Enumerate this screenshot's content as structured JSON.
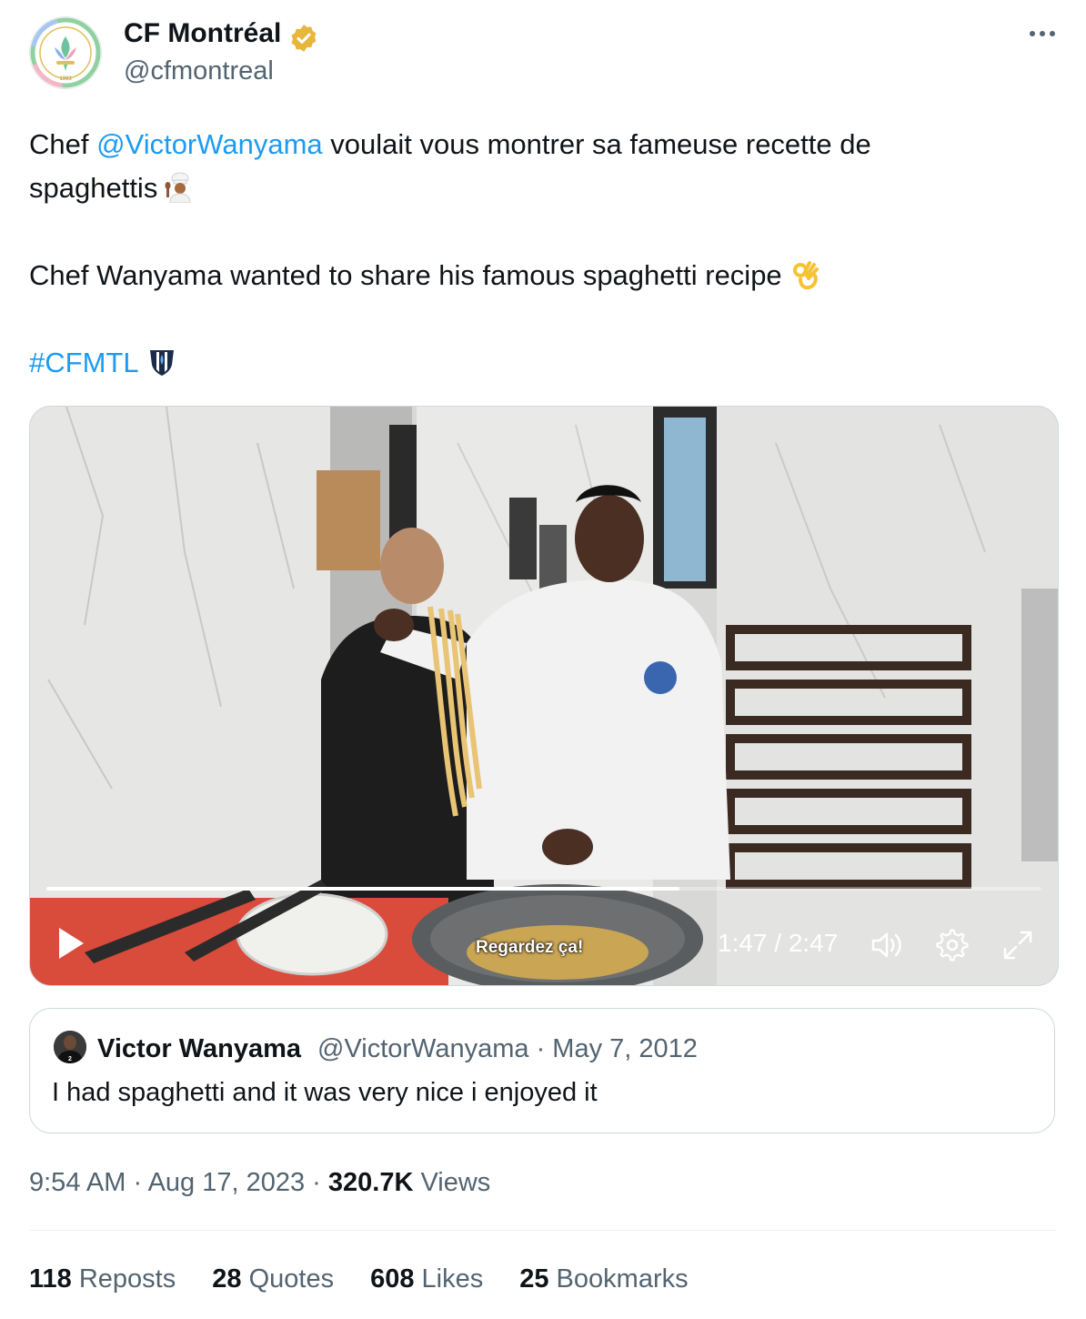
{
  "author": {
    "name": "CF Montréal",
    "handle": "@cfmontreal",
    "logo_text": "CF MONTRÉAL",
    "logo_year": "1993",
    "verified_color": "#e8b63a"
  },
  "tweet": {
    "line1_prefix": "Chef ",
    "mention": "@VictorWanyama",
    "line1_suffix": " voulait vous montrer sa fameuse recette de",
    "line2": "spaghettis",
    "line3": "Chef Wanyama wanted to share his famous spaghetti recipe",
    "hashtag": "#CFMTL",
    "link_color": "#1d9bf0"
  },
  "video": {
    "subtitle": "Regardez ça!",
    "time": "1:47 / 2:47",
    "progress": 0.636
  },
  "quote": {
    "name": "Victor Wanyama",
    "meta": "@VictorWanyama · May 7, 2012",
    "text": "I had spaghetti and it was very nice i enjoyed it"
  },
  "meta": {
    "time": "9:54 AM · Aug 17, 2023 · ",
    "views_count": "320.7K",
    "views_label": " Views"
  },
  "stats": [
    {
      "count": "118",
      "label": " Reposts"
    },
    {
      "count": "28",
      "label": " Quotes"
    },
    {
      "count": "608",
      "label": " Likes"
    },
    {
      "count": "25",
      "label": " Bookmarks"
    }
  ]
}
